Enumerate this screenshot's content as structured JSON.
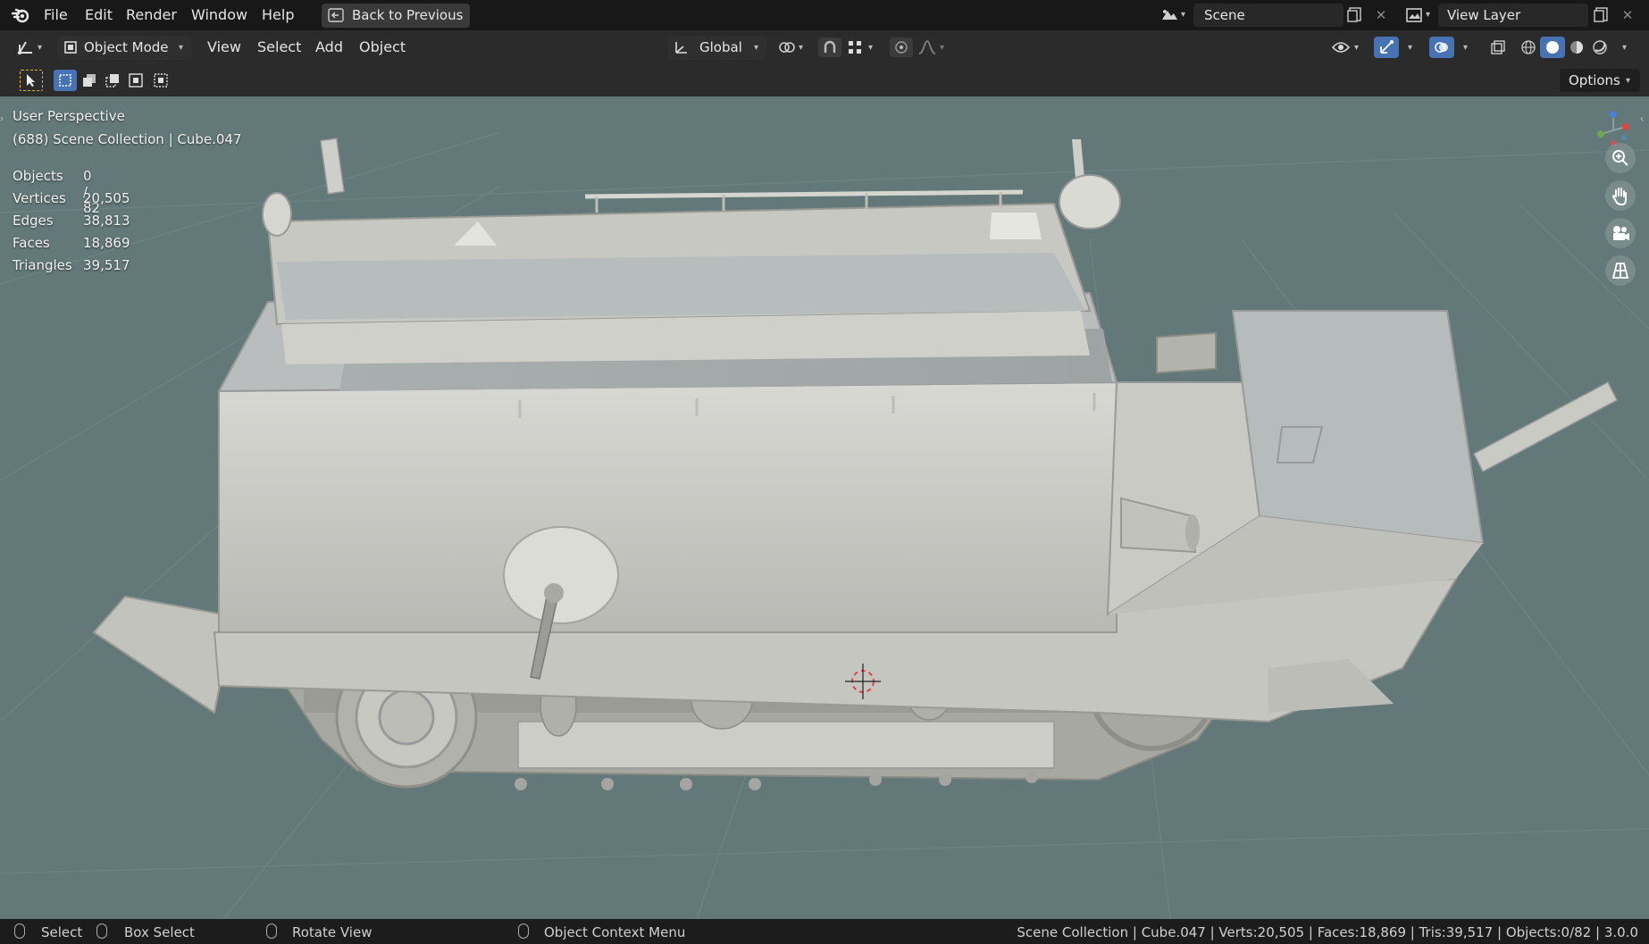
{
  "topbar": {
    "menus": [
      "File",
      "Edit",
      "Render",
      "Window",
      "Help"
    ],
    "back_button": "Back to Previous",
    "scene_name": "Scene",
    "view_layer_name": "View Layer"
  },
  "header": {
    "mode": "Object Mode",
    "menus": [
      "View",
      "Select",
      "Add",
      "Object"
    ],
    "transform_orientation": "Global"
  },
  "tool_header": {
    "options_label": "Options"
  },
  "viewport": {
    "view_name": "User Perspective",
    "collection_info": "(688) Scene Collection | Cube.047",
    "stats": [
      {
        "label": "Objects",
        "value": "0 / 82"
      },
      {
        "label": "Vertices",
        "value": "20,505"
      },
      {
        "label": "Edges",
        "value": "38,813"
      },
      {
        "label": "Faces",
        "value": "18,869"
      },
      {
        "label": "Triangles",
        "value": "39,517"
      }
    ],
    "background_color": "#637878",
    "model_color": "#c9c9c4"
  },
  "statusbar": {
    "select": "Select",
    "box_select": "Box Select",
    "rotate_view": "Rotate View",
    "context_menu": "Object Context Menu",
    "info": "Scene Collection | Cube.047 | Verts:20,505 | Faces:18,869 | Tris:39,517 | Objects:0/82 | 3.0.0"
  },
  "colors": {
    "accent": "#4772b3",
    "active_tool": "#e8b12c"
  }
}
